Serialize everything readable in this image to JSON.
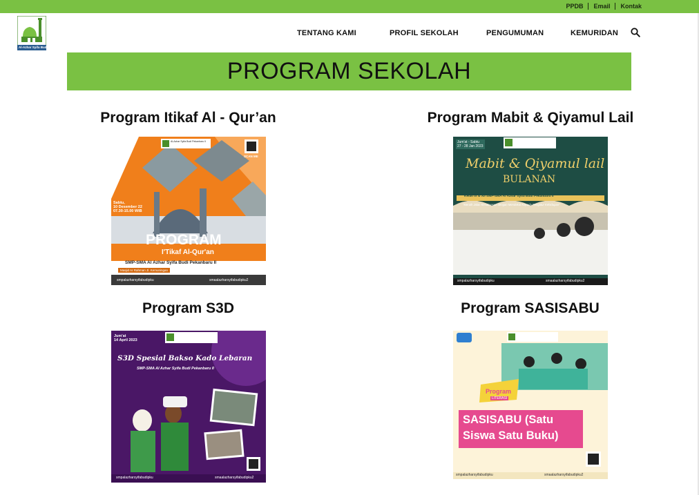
{
  "topbar": {
    "links": [
      "PPDB",
      "Email",
      "Kontak"
    ]
  },
  "logo": {
    "text": "Al-Azhar Syifa Budi"
  },
  "nav": {
    "items": [
      "TENTANG KAMI",
      "PROFIL SEKOLAH",
      "PENGUMUMAN",
      "KEMURIDAN"
    ]
  },
  "banner": {
    "title": "PROGRAM SEKOLAH"
  },
  "programs": [
    {
      "title": "Program Itikaf Al - Qur’an",
      "poster": {
        "school": "Al-Azhar Syifa Budi Pekanbaru II",
        "scan": "SCAN ME",
        "date": "Sabtu,\n10 Desember 22\n07.30-15.00 WIB",
        "headline": "PROGRAM",
        "sub": "I'Tikaf Al-Qur'an",
        "school_line": "SMP-SMA Al Azhar Syifa Budi Pekanbaru II",
        "venue": "Masjid Ar Rahman Jl. Kemuningan",
        "ig1": "smpalazharsyifabudipku",
        "ig2": "smaalazharsyifabudipku2"
      }
    },
    {
      "title": "Program Mabit & Qiyamul Lail",
      "poster": {
        "date": "Jum'at - Sabtu\n27 - 28 Jan 2023",
        "script": "Mabit & Qiyamul lail",
        "sub": "BULANAN",
        "class_line": "Kelas IX & XII SMP-SMA Al Azhar Syifa Budi Pekanbaru II",
        "quote": "\"Meraih Jalan Kesuksesan dengan Mendekat Kepada Pengatur Kehidupan\"",
        "ig1": "smpalazharsyifabudipku",
        "ig2": "smaalazharsyifabudipku2"
      }
    },
    {
      "title": "Program S3D",
      "poster": {
        "date": "Jum'at\n14 April 2023",
        "script": "S3D Spesial Bakso Kado Lebaran",
        "school_line": "SMP-SMA Al Azhar Syifa Budi Pekanbaru II",
        "ig1": "smpalazharsyifabudipku",
        "ig2": "smaalazharsyifabudipku2"
      }
    },
    {
      "title": "Program SASISABU",
      "poster": {
        "tag1": "Program",
        "tag2": "LITERASI",
        "headline": "SASISABU (Satu Siswa Satu Buku)",
        "ig1": "smpalazharsyifabudipku",
        "ig2": "smaalazharsyifabudipku2"
      }
    }
  ],
  "colors": {
    "brand_green": "#7ac143",
    "orange": "#f07f1b",
    "teal": "#1e4d44",
    "purple": "#5a1f7a",
    "pink": "#e64a8f",
    "cream": "#fff5d6"
  }
}
